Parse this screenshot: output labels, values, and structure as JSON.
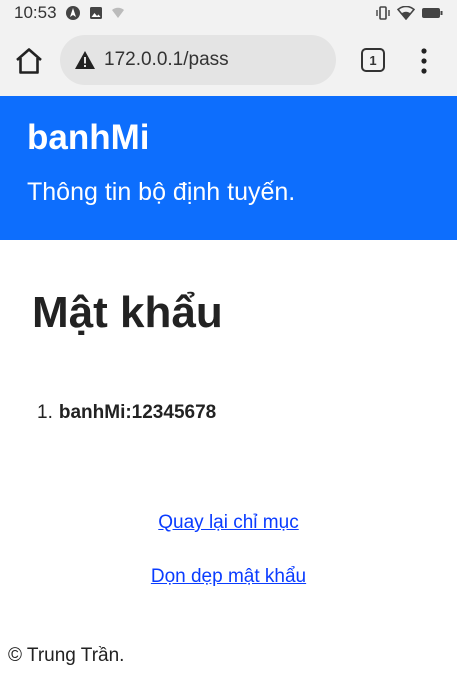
{
  "status_bar": {
    "time": "10:53",
    "icons": [
      "navigation-icon",
      "image-notification-icon",
      "wifi-weak-icon",
      "vibrate-icon",
      "wifi-icon",
      "battery-icon"
    ]
  },
  "browser": {
    "url": "172.0.0.1/pass",
    "tab_count": "1",
    "security_icon": "warning-icon"
  },
  "header": {
    "brand": "banhMi",
    "tagline": "Thông tin bộ định tuyến."
  },
  "main": {
    "title": "Mật khẩu",
    "passwords": [
      {
        "index": "1.",
        "entry": "banhMi:12345678"
      }
    ],
    "links": {
      "back": "Quay lại chỉ mục",
      "clear": "Dọn dẹp mật khẩu"
    }
  },
  "footer": {
    "text": "© Trung Trần."
  },
  "colors": {
    "header_bg": "#0d6efd",
    "link": "#0a3cff"
  }
}
